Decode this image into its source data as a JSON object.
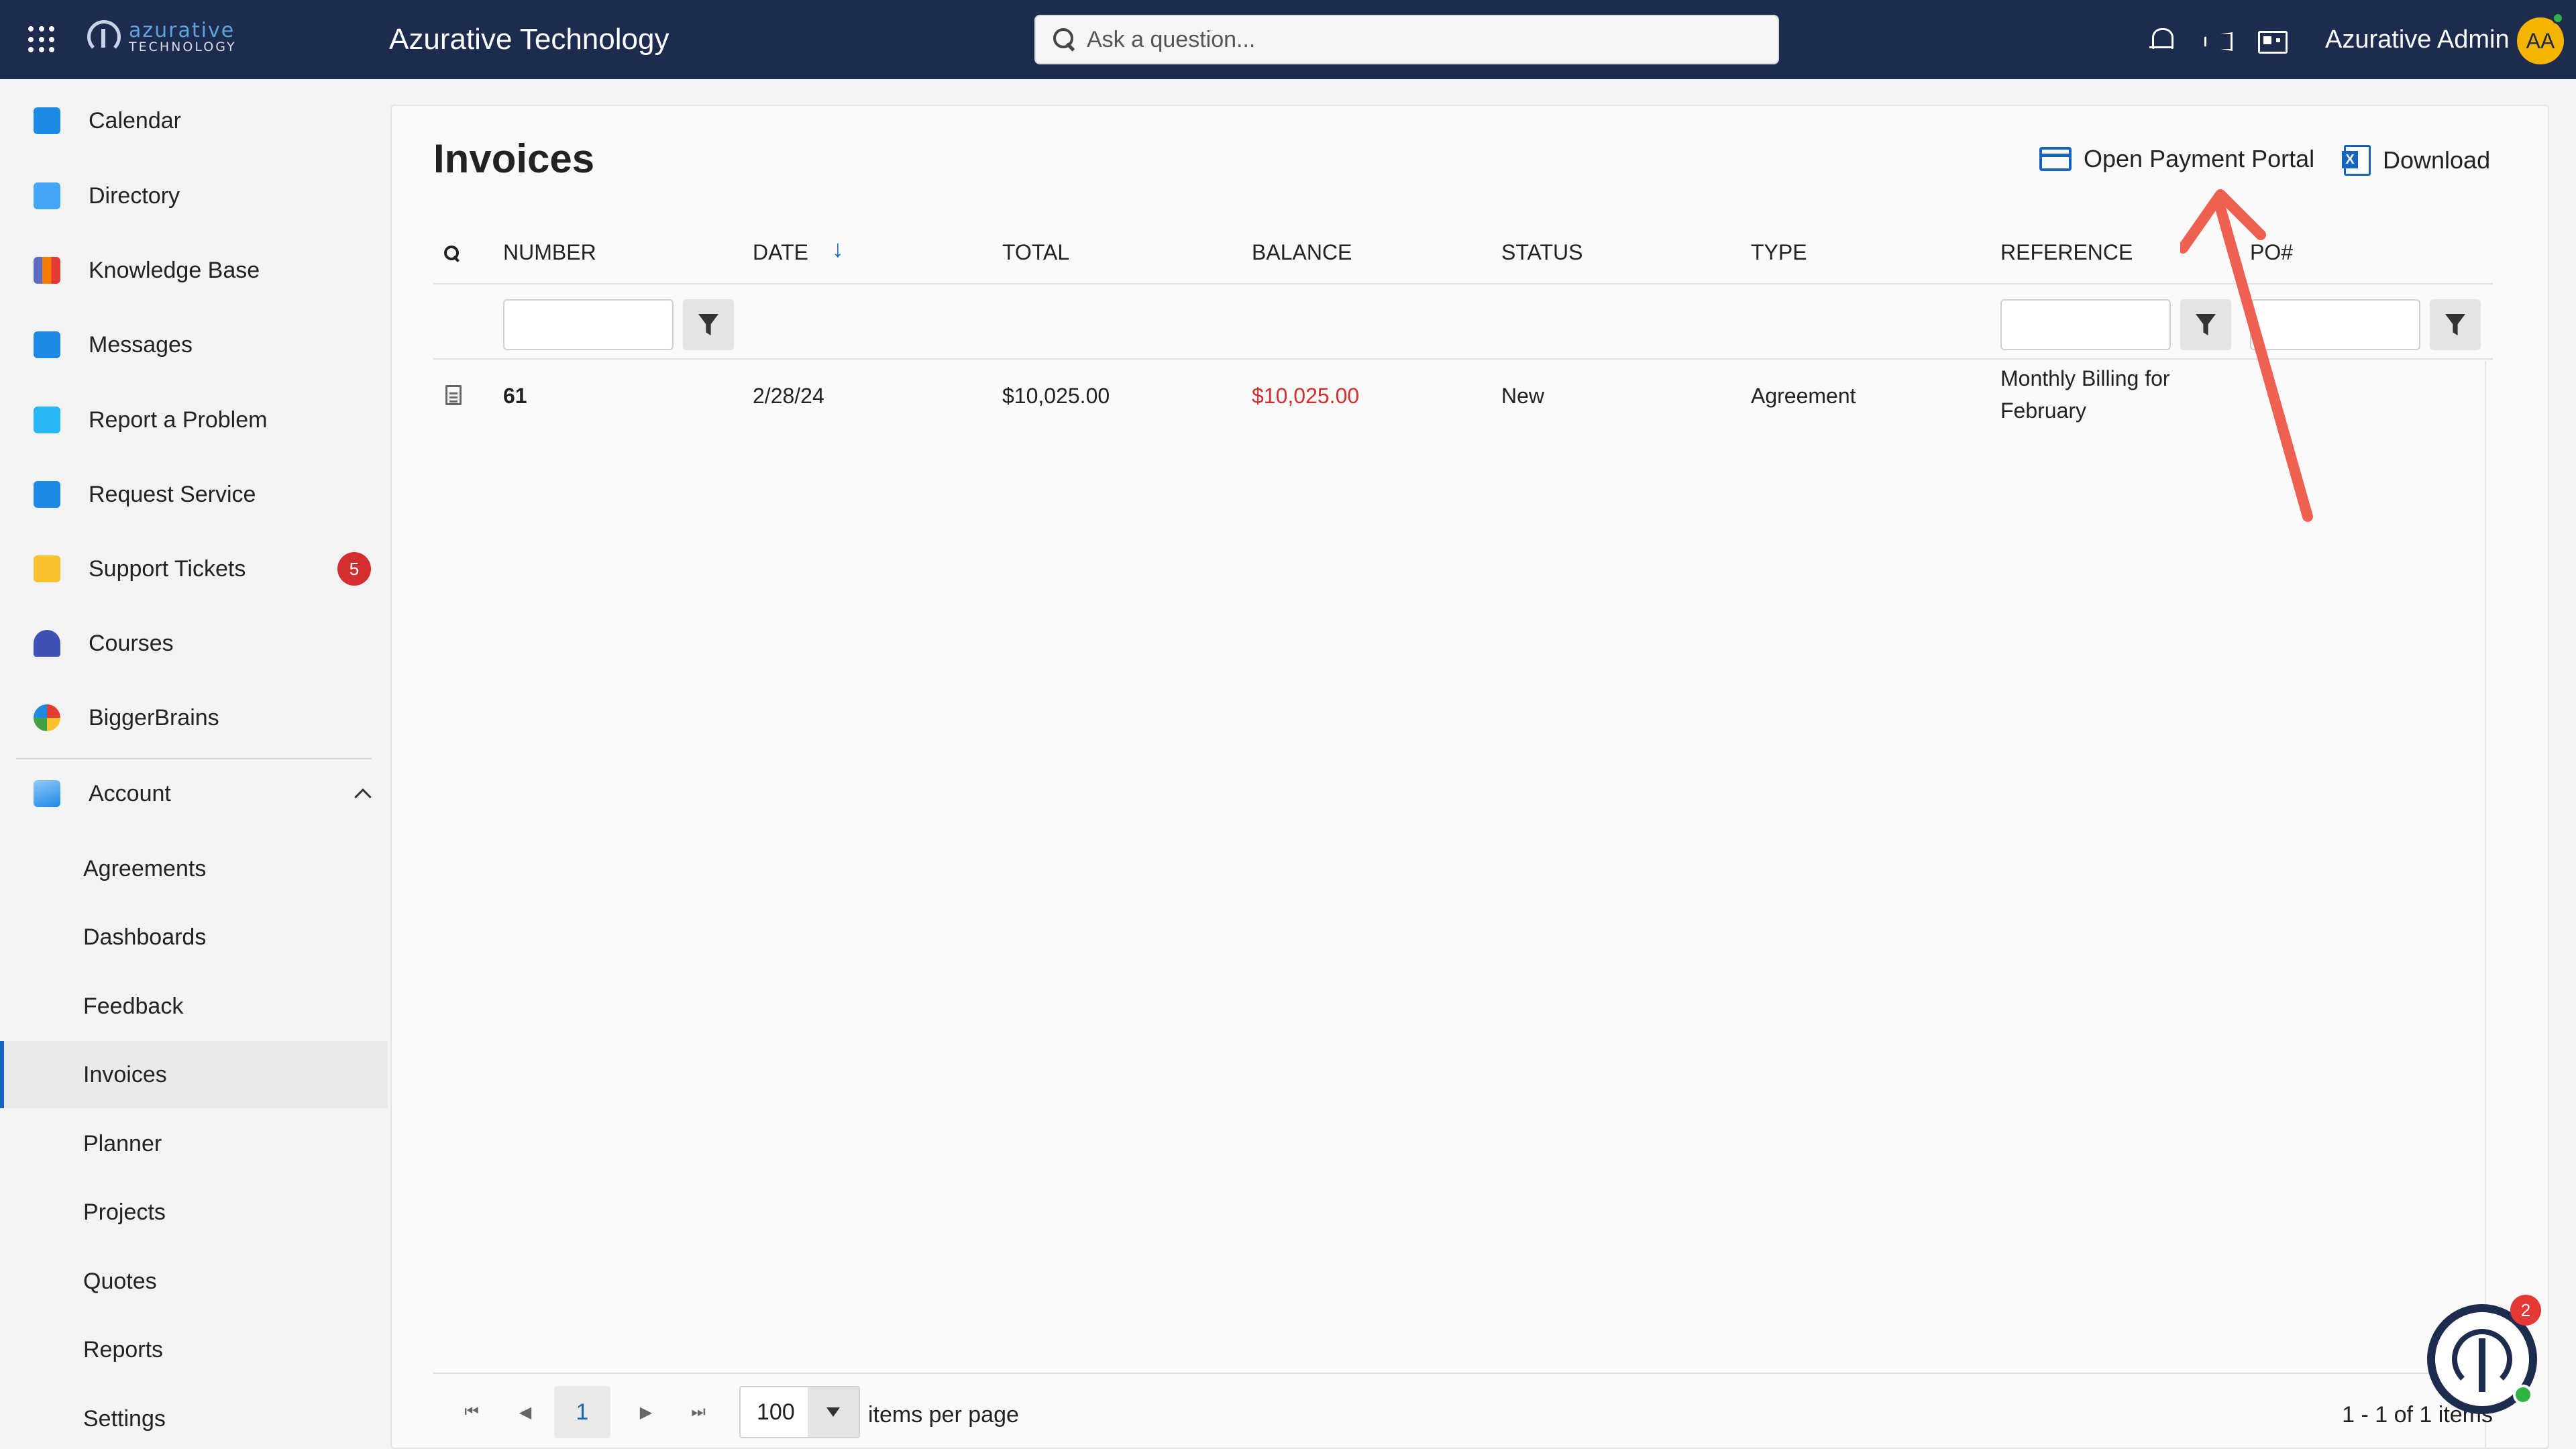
{
  "header": {
    "logo_line1": "azurative",
    "logo_line2": "TECHNOLOGY",
    "app_title": "Azurative Technology",
    "search_placeholder": "Ask a question...",
    "user_name": "Azurative Admin",
    "user_initials": "AA"
  },
  "sidebar": {
    "items": [
      {
        "label": "Calendar",
        "icon": "calendar-icon"
      },
      {
        "label": "Directory",
        "icon": "directory-icon"
      },
      {
        "label": "Knowledge Base",
        "icon": "books-icon"
      },
      {
        "label": "Messages",
        "icon": "mail-icon"
      },
      {
        "label": "Report a Problem",
        "icon": "clipboard-icon"
      },
      {
        "label": "Request Service",
        "icon": "tools-icon"
      },
      {
        "label": "Support Tickets",
        "icon": "folder-icon",
        "badge": "5"
      },
      {
        "label": "Courses",
        "icon": "graduation-cap-icon"
      },
      {
        "label": "BiggerBrains",
        "icon": "brain-icon"
      }
    ],
    "account": {
      "label": "Account",
      "icon": "chart-icon"
    },
    "account_items": [
      "Agreements",
      "Dashboards",
      "Feedback",
      "Invoices",
      "Planner",
      "Projects",
      "Quotes",
      "Reports",
      "Settings"
    ],
    "active_item": "Invoices"
  },
  "main": {
    "title": "Invoices",
    "actions": {
      "open_portal": "Open Payment Portal",
      "download": "Download"
    },
    "columns": [
      "NUMBER",
      "DATE",
      "TOTAL",
      "BALANCE",
      "STATUS",
      "TYPE",
      "REFERENCE",
      "PO#"
    ],
    "sort_indicator": "↓",
    "rows": [
      {
        "number": "61",
        "date": "2/28/24",
        "total": "$10,025.00",
        "balance": "$10,025.00",
        "status": "New",
        "type": "Agreement",
        "reference_line1": "Monthly Billing for",
        "reference_line2": "February",
        "po": ""
      }
    ],
    "pager": {
      "current_page": "1",
      "page_size": "100",
      "items_per_page_label": "items per page",
      "info": "1 - 1 of 1 items"
    }
  },
  "help_widget": {
    "badge": "2"
  },
  "colors": {
    "topbar": "#1d2b4f",
    "accent": "#1565c0",
    "balance_red": "#d32f2f",
    "badge_red": "#d32f2f",
    "arrow": "#f06050",
    "avatar": "#f5b400"
  }
}
